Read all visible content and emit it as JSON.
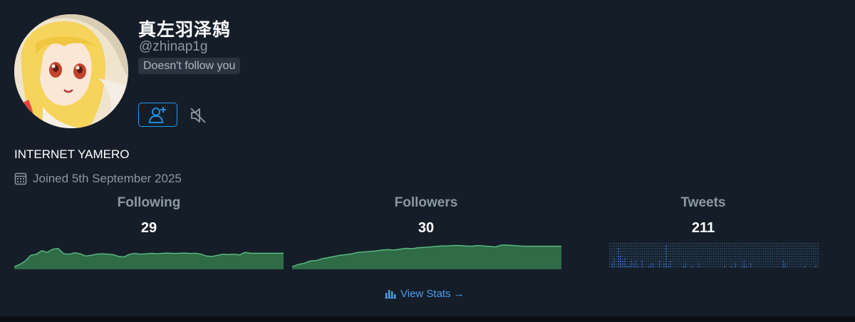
{
  "profile": {
    "display_name": "真左羽泽鸫",
    "handle": "@zhinap1g",
    "follow_status": "Doesn't follow you",
    "bio": "INTERNET YAMERO",
    "joined": "Joined 5th September 2025"
  },
  "stats": {
    "following": {
      "label": "Following",
      "value": "29",
      "trend": [
        0.05,
        0.15,
        0.3,
        0.55,
        0.6,
        0.75,
        0.68,
        0.82,
        0.85,
        0.62,
        0.6,
        0.66,
        0.62,
        0.52,
        0.55,
        0.6,
        0.62,
        0.6,
        0.58,
        0.5,
        0.48,
        0.6,
        0.63,
        0.6,
        0.62,
        0.64,
        0.62,
        0.64,
        0.65,
        0.63,
        0.64,
        0.65,
        0.63,
        0.64,
        0.6,
        0.52,
        0.5,
        0.55,
        0.6,
        0.58,
        0.6,
        0.57,
        0.68,
        0.64,
        0.64,
        0.64,
        0.64,
        0.64,
        0.64,
        0.64
      ]
    },
    "followers": {
      "label": "Followers",
      "value": "30",
      "trend": [
        0.05,
        0.15,
        0.2,
        0.3,
        0.32,
        0.4,
        0.45,
        0.5,
        0.55,
        0.58,
        0.62,
        0.68,
        0.7,
        0.72,
        0.74,
        0.78,
        0.8,
        0.78,
        0.82,
        0.86,
        0.84,
        0.88,
        0.9,
        0.92,
        0.94,
        0.96,
        0.96,
        0.98,
        0.98,
        0.96,
        0.95,
        0.98,
        0.96,
        0.94,
        0.92,
        1.0,
        1.0,
        0.98,
        0.96,
        0.95,
        0.95,
        0.95,
        0.95,
        0.95,
        0.95,
        0.95
      ]
    },
    "tweets": {
      "label": "Tweets",
      "value": "211",
      "activity": [
        0,
        2,
        4,
        0,
        8,
        5,
        3,
        4,
        1,
        1,
        3,
        2,
        3,
        1,
        0,
        3,
        0,
        0,
        1,
        2,
        2,
        0,
        0,
        3,
        0,
        2,
        9,
        1,
        3,
        0,
        0,
        0,
        0,
        0,
        1,
        2,
        0,
        0,
        1,
        0,
        0,
        2,
        0,
        0,
        0,
        0,
        0,
        0,
        0,
        0,
        0,
        0,
        0,
        1,
        0,
        0,
        1,
        0,
        2,
        0,
        0,
        1,
        3,
        1,
        0,
        2,
        0,
        0,
        0,
        0,
        0,
        0,
        0,
        0,
        0,
        0,
        0,
        0,
        0,
        0,
        3,
        2,
        0,
        0,
        0,
        0,
        0,
        0,
        0,
        0,
        1,
        0,
        0,
        0,
        0,
        1,
        0
      ]
    }
  },
  "view_stats_label": "View Stats →",
  "colors": {
    "accent": "#1d9bf0",
    "spark_fill": "#2f6b46",
    "spark_line": "#58b97f",
    "tweet_dot": "#2c4761",
    "tweet_bar": "#3d7fd6"
  }
}
